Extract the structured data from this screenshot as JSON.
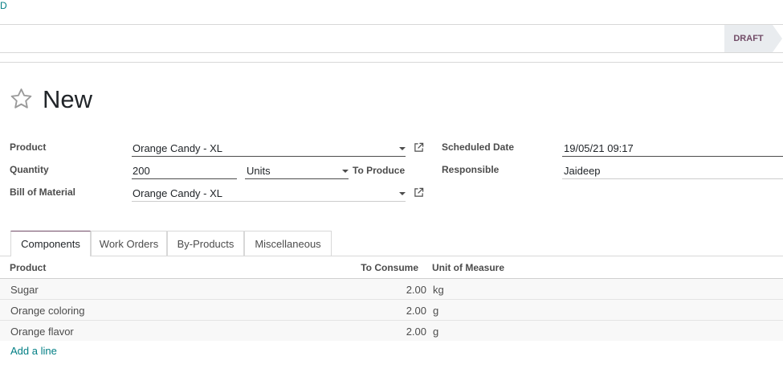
{
  "breadcrumb": {
    "fragment": "D"
  },
  "status": {
    "stage": "DRAFT"
  },
  "record": {
    "title": "New"
  },
  "fields": {
    "product": {
      "label": "Product",
      "value": "Orange Candy - XL"
    },
    "quantity": {
      "label": "Quantity",
      "value": "200",
      "uom": "Units",
      "suffix": "To Produce"
    },
    "bom": {
      "label": "Bill of Material",
      "value": "Orange Candy - XL"
    },
    "scheduled_date": {
      "label": "Scheduled Date",
      "value": "19/05/21 09:17"
    },
    "responsible": {
      "label": "Responsible",
      "value": "Jaideep"
    }
  },
  "tabs": [
    {
      "label": "Components"
    },
    {
      "label": "Work Orders"
    },
    {
      "label": "By-Products"
    },
    {
      "label": "Miscellaneous"
    }
  ],
  "components_table": {
    "headers": {
      "product": "Product",
      "to_consume": "To Consume",
      "uom": "Unit of Measure"
    },
    "rows": [
      {
        "product": "Sugar",
        "to_consume": "2.00",
        "uom": "kg"
      },
      {
        "product": "Orange coloring",
        "to_consume": "2.00",
        "uom": "g"
      },
      {
        "product": "Orange flavor",
        "to_consume": "2.00",
        "uom": "g"
      }
    ],
    "add_line": "Add a line"
  },
  "colors": {
    "accent": "#714b67",
    "link": "#017e84"
  },
  "icons": [
    "star-icon",
    "external-link-icon",
    "caret-down-icon"
  ]
}
